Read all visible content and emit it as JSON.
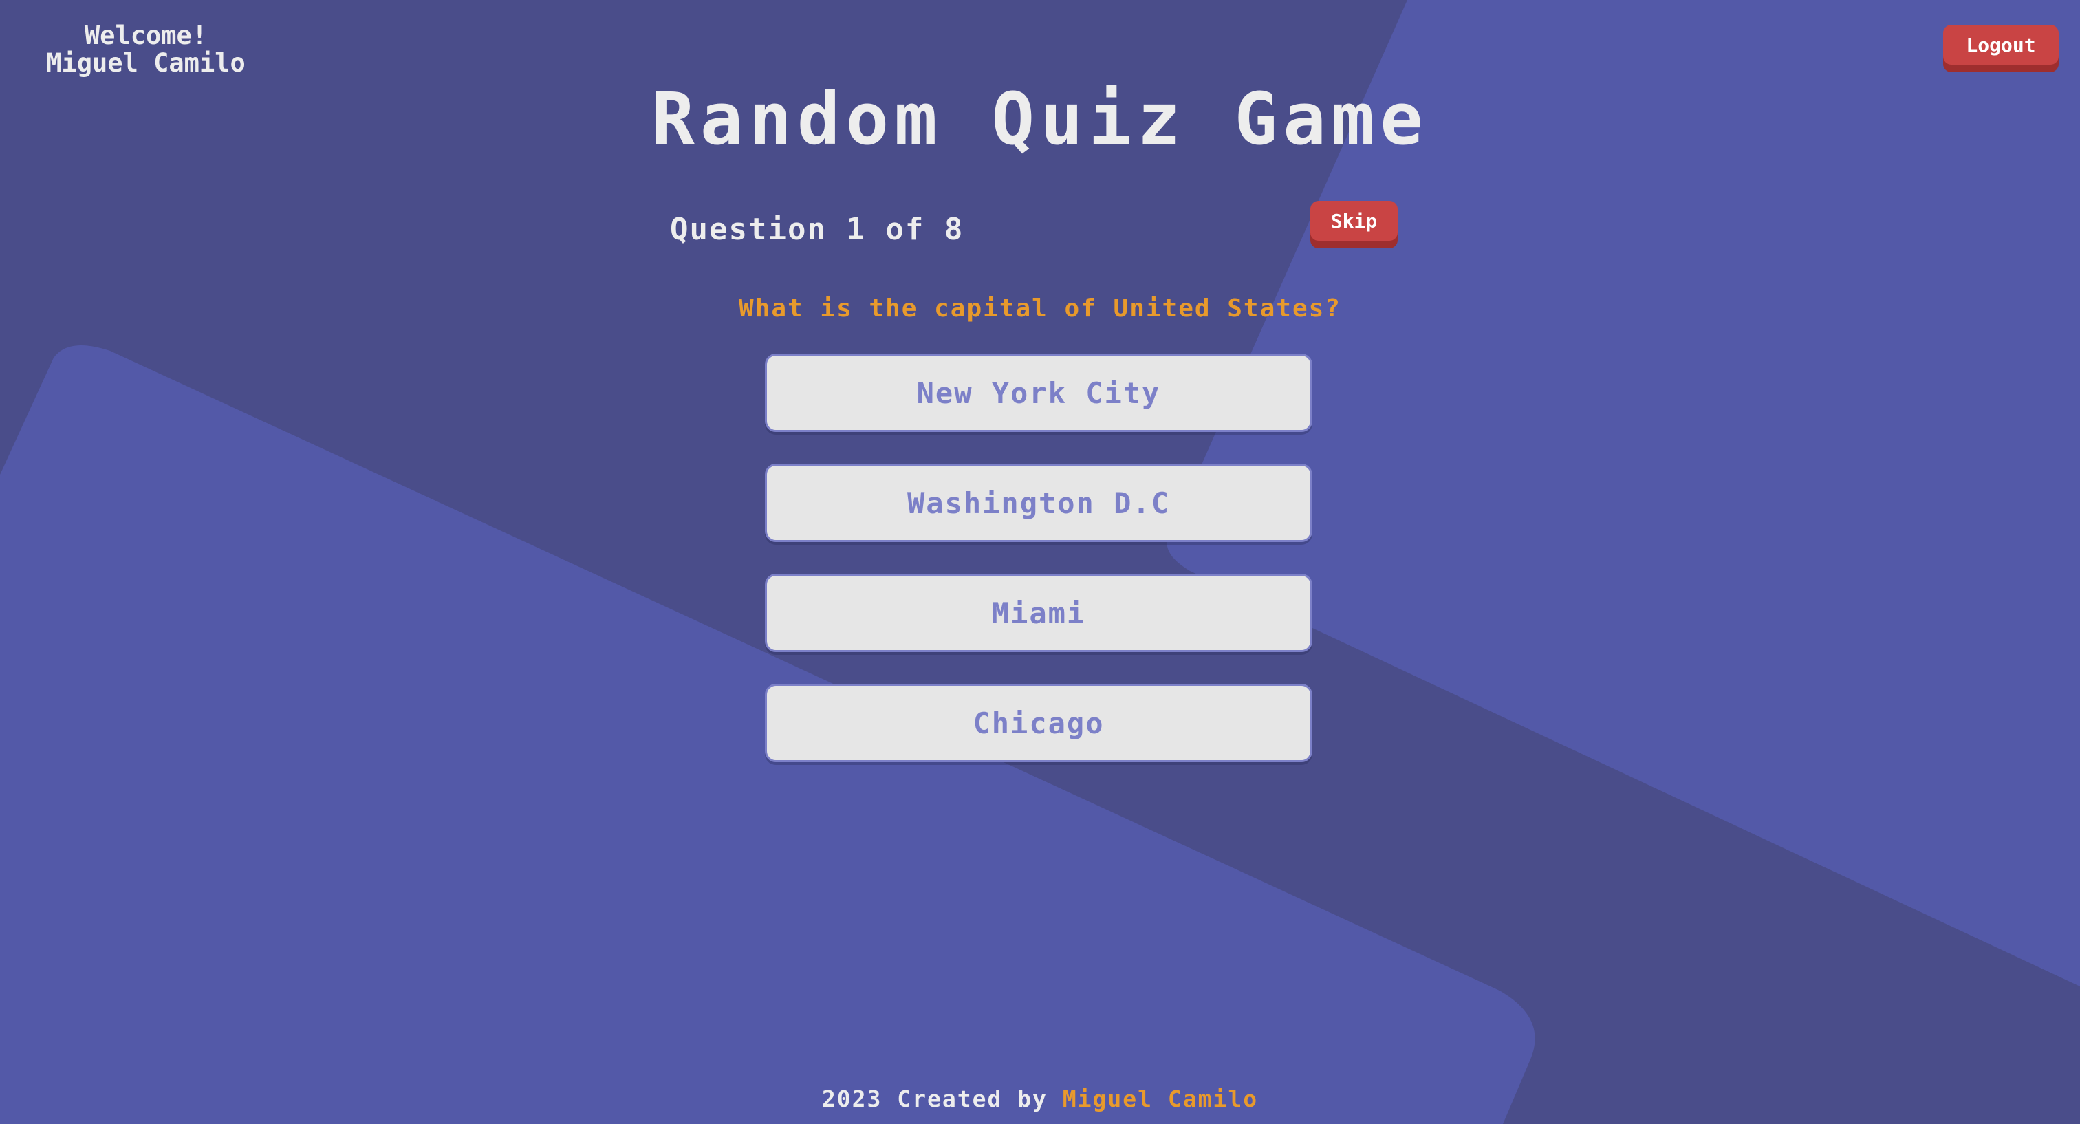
{
  "header": {
    "welcome_line": "Welcome!",
    "user_name": "Miguel Camilo",
    "logout_label": "Logout"
  },
  "game": {
    "title": "Random Quiz Game",
    "counter": "Question 1 of 8",
    "skip_label": "Skip",
    "question": "What is the capital of United States?",
    "answers": [
      "New York City",
      "Washington D.C",
      "Miami",
      "Chicago"
    ]
  },
  "footer": {
    "prefix": "2023 Created by",
    "author": "Miguel Camilo"
  },
  "colors": {
    "background": "#4a4d8a",
    "shape": "#5359a8",
    "accent": "#e89a2c",
    "danger": "#c94444",
    "answer_bg": "#e6e6e6",
    "answer_text": "#7c80c8"
  }
}
